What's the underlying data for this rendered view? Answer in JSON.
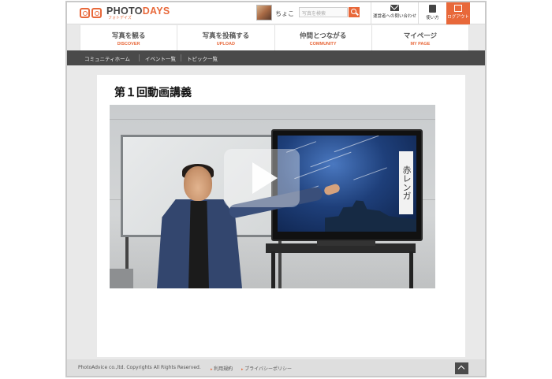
{
  "header": {
    "logo_main_1": "PHOTO",
    "logo_main_2": "DAYS",
    "logo_sub": "フォトデイズ",
    "username": "ちょこ",
    "search_placeholder": "写真を検索",
    "tools": {
      "contact_label": "運営者への問い合わせ",
      "howto_label": "使い方",
      "logout_label": "ログアウト"
    }
  },
  "main_nav": [
    {
      "jp": "写真を観る",
      "en": "DISCOVER"
    },
    {
      "jp": "写真を投稿する",
      "en": "UPLOAD"
    },
    {
      "jp": "仲間とつながる",
      "en": "COMMUNITY"
    },
    {
      "jp": "マイページ",
      "en": "MY PAGE"
    }
  ],
  "sub_nav": [
    "コミュニティホーム",
    "イベント一覧",
    "トピック一覧"
  ],
  "content": {
    "title": "第１回動画講義",
    "video_tv_text": "赤レンガ"
  },
  "footer": {
    "copyright": "PhotoAdvice co.,ltd. Copyrights All Rights Reserved.",
    "links": [
      "利用規約",
      "プライバシーポリシー"
    ]
  },
  "colors": {
    "accent": "#e8683a",
    "subnav_bg": "#4a4a4a",
    "frame_bg": "#e9e9e9"
  }
}
